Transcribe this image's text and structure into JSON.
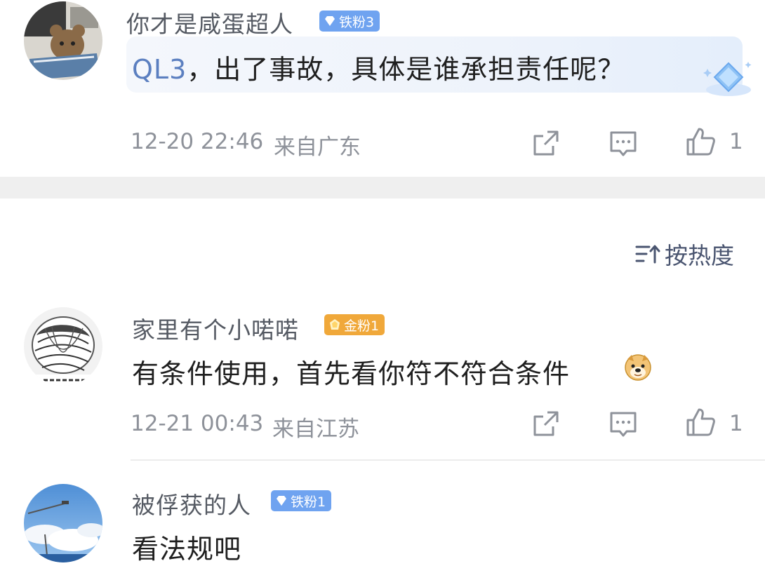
{
  "top_comment": {
    "username": "你才是咸蛋超人",
    "badge": "铁粉3",
    "mention": "QL3",
    "text": "，出了事故，具体是谁承担责任呢？",
    "date": "12-20 22:46",
    "location": "来自广东",
    "likes": "1"
  },
  "sort": {
    "label": "按热度",
    "icon": "sort-icon"
  },
  "comments": [
    {
      "username": "家里有个小喏喏",
      "badge": "金粉1",
      "text": "有条件使用，首先看你符不符合条件",
      "emoji": "doge-emoji",
      "date": "12-21 00:43",
      "location": "来自江苏",
      "likes": "1"
    },
    {
      "username": "被俘获的人",
      "badge": "铁粉1",
      "text": "看法规吧"
    }
  ],
  "colors": {
    "iron_badge": "#6fa3f0",
    "gold_badge": "#f0a83a",
    "mention": "#5b7fc0",
    "meta": "#8e929a"
  }
}
